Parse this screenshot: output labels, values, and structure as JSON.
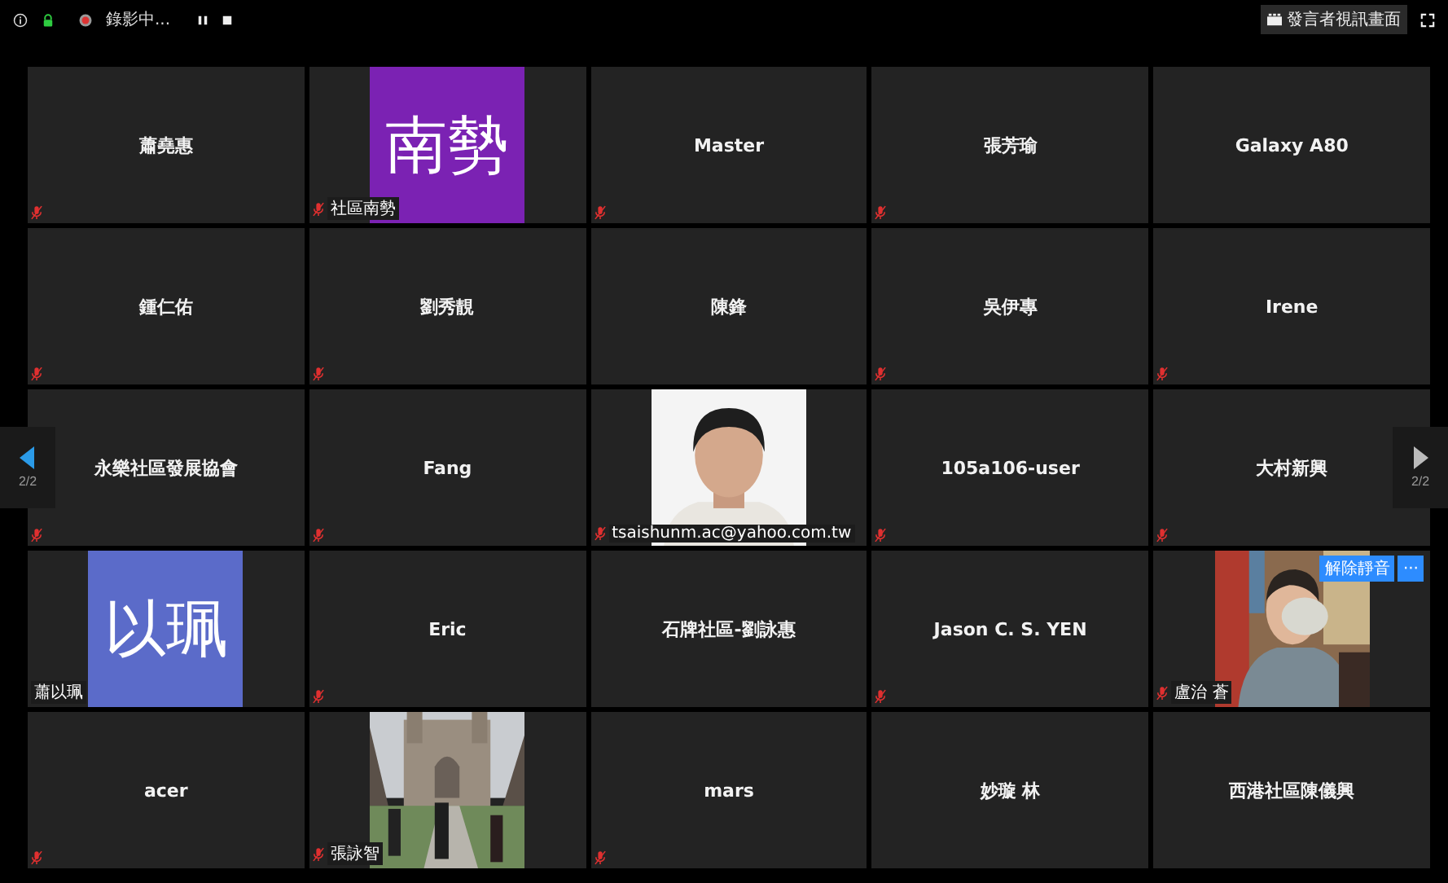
{
  "top_bar": {
    "recording_label": "錄影中...",
    "view_button": "發言者視訊畫面"
  },
  "pager": {
    "left": "2/2",
    "right": "2/2"
  },
  "tiles": [
    {
      "kind": "name",
      "name": "蕭堯惠",
      "muted": true
    },
    {
      "kind": "avatar",
      "avatar_text": "南勢",
      "color": "#7b22b3",
      "label": "社區南勢",
      "muted": true
    },
    {
      "kind": "name",
      "name": "Master",
      "muted": true
    },
    {
      "kind": "name",
      "name": "張芳瑜",
      "muted": true
    },
    {
      "kind": "name",
      "name": "Galaxy A80",
      "muted": false
    },
    {
      "kind": "name",
      "name": "鍾仁佑",
      "muted": true
    },
    {
      "kind": "name",
      "name": "劉秀靚",
      "muted": true
    },
    {
      "kind": "name",
      "name": "陳鋒",
      "muted": false
    },
    {
      "kind": "name",
      "name": "吳伊專",
      "muted": true
    },
    {
      "kind": "name",
      "name": "Irene",
      "muted": true
    },
    {
      "kind": "name",
      "name": "永樂社區發展協會",
      "muted": true
    },
    {
      "kind": "name",
      "name": "Fang",
      "muted": true
    },
    {
      "label": "tsaishunm.ac@yahoo.com.tw",
      "muted": true
    },
    {
      "kind": "name",
      "name": "105a106-user",
      "muted": true
    },
    {
      "kind": "name",
      "name": "大村新興",
      "muted": true
    },
    {
      "kind": "avatar",
      "avatar_text": "以珮",
      "color": "#5b6bc9",
      "label": "蕭以珮",
      "muted": false
    },
    {
      "kind": "name",
      "name": "Eric",
      "muted": true
    },
    {
      "kind": "name",
      "name": "石牌社區-劉詠惠",
      "muted": false
    },
    {
      "kind": "name",
      "name": "Jason C. S. YEN",
      "muted": true
    },
    {
      "label": "盧治 蒼",
      "muted": true,
      "buttons": [
        "解除靜音",
        "···"
      ]
    },
    {
      "kind": "name",
      "name": "acer",
      "muted": true
    },
    {
      "label": "張詠智",
      "muted": true
    },
    {
      "kind": "name",
      "name": "mars",
      "muted": true
    },
    {
      "kind": "name",
      "name": "妙璇 林",
      "muted": false
    },
    {
      "kind": "name",
      "name": "西港社區陳儀興",
      "muted": false
    }
  ]
}
